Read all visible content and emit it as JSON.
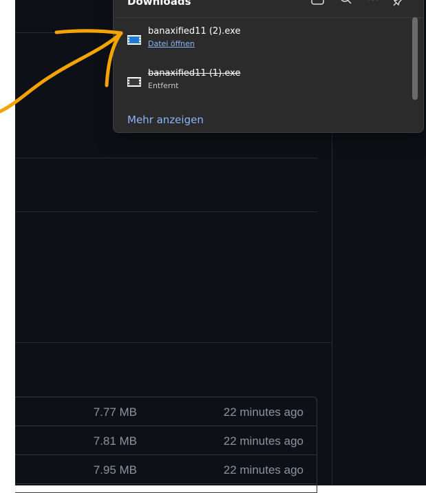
{
  "downloads_panel": {
    "title": "Downloads",
    "header_icons": [
      "folder-icon",
      "search-icon",
      "more-icon",
      "pin-icon"
    ],
    "items": [
      {
        "name": "banaxified11 (2).exe",
        "action": "Datei öffnen",
        "icon": "exe-file-icon"
      },
      {
        "name": "banaxified11 (1).exe",
        "status": "Entfernt",
        "icon": "exe-file-icon"
      }
    ],
    "more_label": "Mehr anzeigen"
  },
  "assets": [
    {
      "size": "7.77 MB",
      "time": "22 minutes ago"
    },
    {
      "size": "7.81 MB",
      "time": "22 minutes ago"
    },
    {
      "size": "7.95 MB",
      "time": "22 minutes ago"
    }
  ],
  "annotation": {
    "color": "#f5a300"
  },
  "colors": {
    "page_bg": "#0d1117",
    "panel_bg": "#2b2b2b",
    "link": "#8ab4f8",
    "muted_text": "#8b949e"
  }
}
